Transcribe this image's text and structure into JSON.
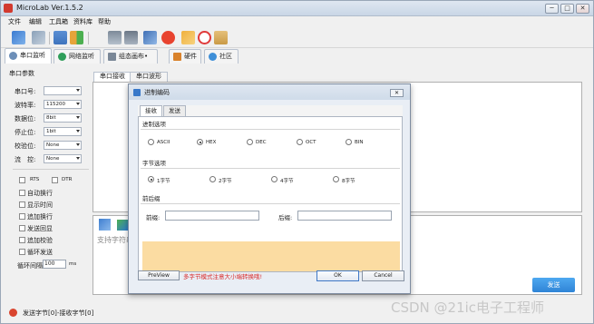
{
  "app": {
    "title": "MicroLab Ver.1.5.2"
  },
  "window_controls": {
    "minimize": "─",
    "maximize": "□",
    "close": "✕"
  },
  "menu": [
    "文件",
    "编辑",
    "工具箱",
    "资料库",
    "帮助"
  ],
  "toolbar_icons": [
    "connect-icon",
    "disconnect-icon",
    "layout-icon",
    "transfer-icon",
    "calculator-icon",
    "list-icon",
    "wand-icon",
    "c-language-icon",
    "key-icon",
    "heart-icon",
    "book-icon"
  ],
  "main_tabs": [
    {
      "label": "串口监听",
      "icon": "pin-icon"
    },
    {
      "label": "网络监听",
      "icon": "globe-icon"
    },
    {
      "label": "组态画布•",
      "icon": "canvas-icon"
    },
    {
      "label": "硬件",
      "icon": "hardware-icon"
    },
    {
      "label": "社区",
      "icon": "community-icon"
    }
  ],
  "serial_params": {
    "title": "串口参数",
    "fields": [
      {
        "label": "串口号:",
        "value": ""
      },
      {
        "label": "波特率:",
        "value": "115200"
      },
      {
        "label": "数据位:",
        "value": "8bit"
      },
      {
        "label": "停止位:",
        "value": "1bit"
      },
      {
        "label": "校验位:",
        "value": "None"
      },
      {
        "label": "流　控:",
        "value": "None"
      }
    ],
    "rts_label": "RTS",
    "dtr_label": "DTR",
    "options": [
      "自动换行",
      "显示时间",
      "追加换行",
      "发送回显",
      "追加校验",
      "循环发送"
    ],
    "loop_interval_label": "循环间隔",
    "loop_interval_value": "100",
    "loop_interval_unit": "ms"
  },
  "rx_tabs": [
    "串口接收",
    "串口波形"
  ],
  "tx": {
    "hint": "支持字符串",
    "send_label": "发送"
  },
  "status": {
    "text": "发送字节[0]-接收字节[0]"
  },
  "watermark": "CSDN @21ic电子工程师",
  "dialog": {
    "title": "进制编码",
    "close": "✕",
    "tabs": [
      "接收",
      "发送"
    ],
    "base_group_title": "进制选项",
    "base_options": [
      {
        "label": "ASCII",
        "checked": false
      },
      {
        "label": "HEX",
        "checked": true
      },
      {
        "label": "DEC",
        "checked": false
      },
      {
        "label": "OCT",
        "checked": false
      },
      {
        "label": "BIN",
        "checked": false
      }
    ],
    "byte_group_title": "字节选项",
    "byte_options": [
      {
        "label": "1字节",
        "checked": true
      },
      {
        "label": "2字节",
        "checked": false
      },
      {
        "label": "4字节",
        "checked": false
      },
      {
        "label": "8字节",
        "checked": false
      }
    ],
    "affix_group_title": "前后缀",
    "prefix_label": "前缀:",
    "prefix_value": "",
    "suffix_label": "后缀:",
    "suffix_value": "",
    "preview_label": "PreView",
    "warning": "多字节模式注意大小端转换哦!",
    "ok_label": "OK",
    "cancel_label": "Cancel"
  }
}
